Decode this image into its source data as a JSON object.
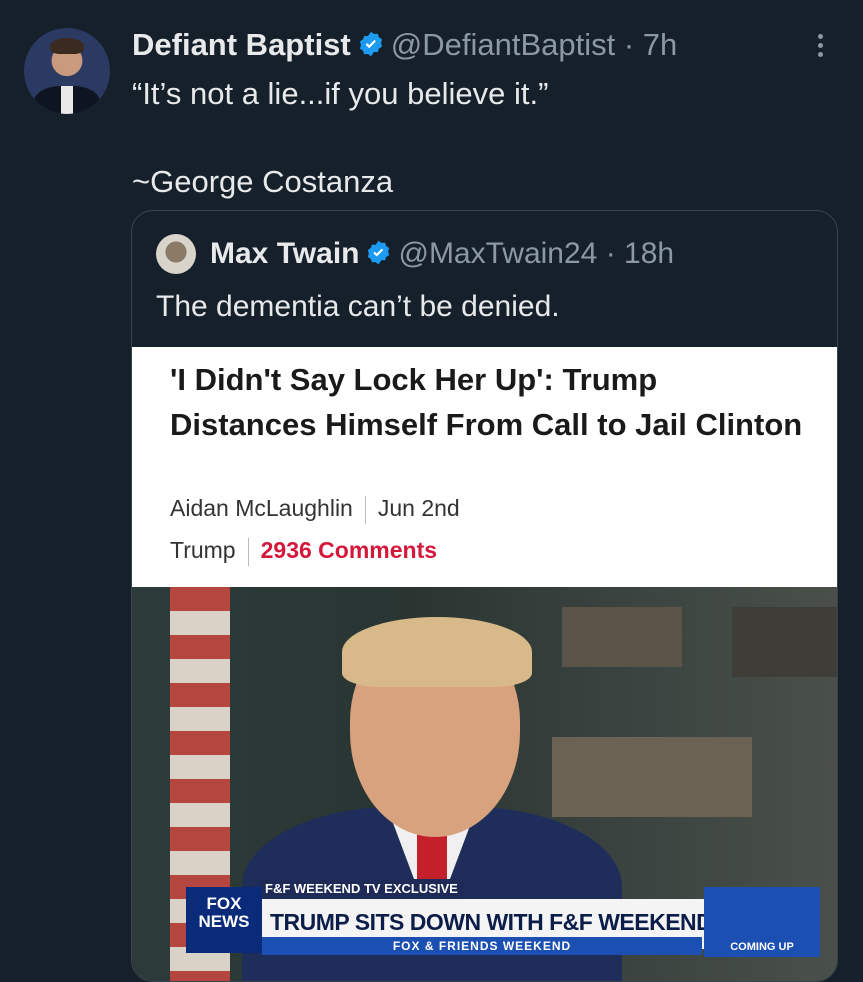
{
  "tweet": {
    "author_name": "Defiant Baptist",
    "handle": "@DefiantBaptist",
    "time": "· 7h",
    "text": "“It’s not a lie...if you believe it.”\n\n~George Costanza"
  },
  "quote": {
    "author_name": "Max Twain",
    "handle": "@MaxTwain24",
    "time": "· 18h",
    "text": "The dementia can’t be denied.",
    "card": {
      "headline": "'I Didn't Say Lock Her Up': Trump Distances Himself From Call to Jail Clinton",
      "author": "Aidan McLaughlin",
      "date": "Jun 2nd",
      "tag": "Trump",
      "comments": "2936 Comments"
    },
    "photo": {
      "chyron_tag": "F&F WEEKEND TV EXCLUSIVE",
      "chyron_text": "TRUMP SITS DOWN WITH F&F WEEKEND",
      "logo_text": "FOX NEWS",
      "bar_text": "FOX & FRIENDS WEEKEND",
      "coming_up": "COMING UP"
    }
  },
  "colors": {
    "background": "#15202b",
    "verified": "#1d9bf0",
    "comments": "#d4173a"
  }
}
